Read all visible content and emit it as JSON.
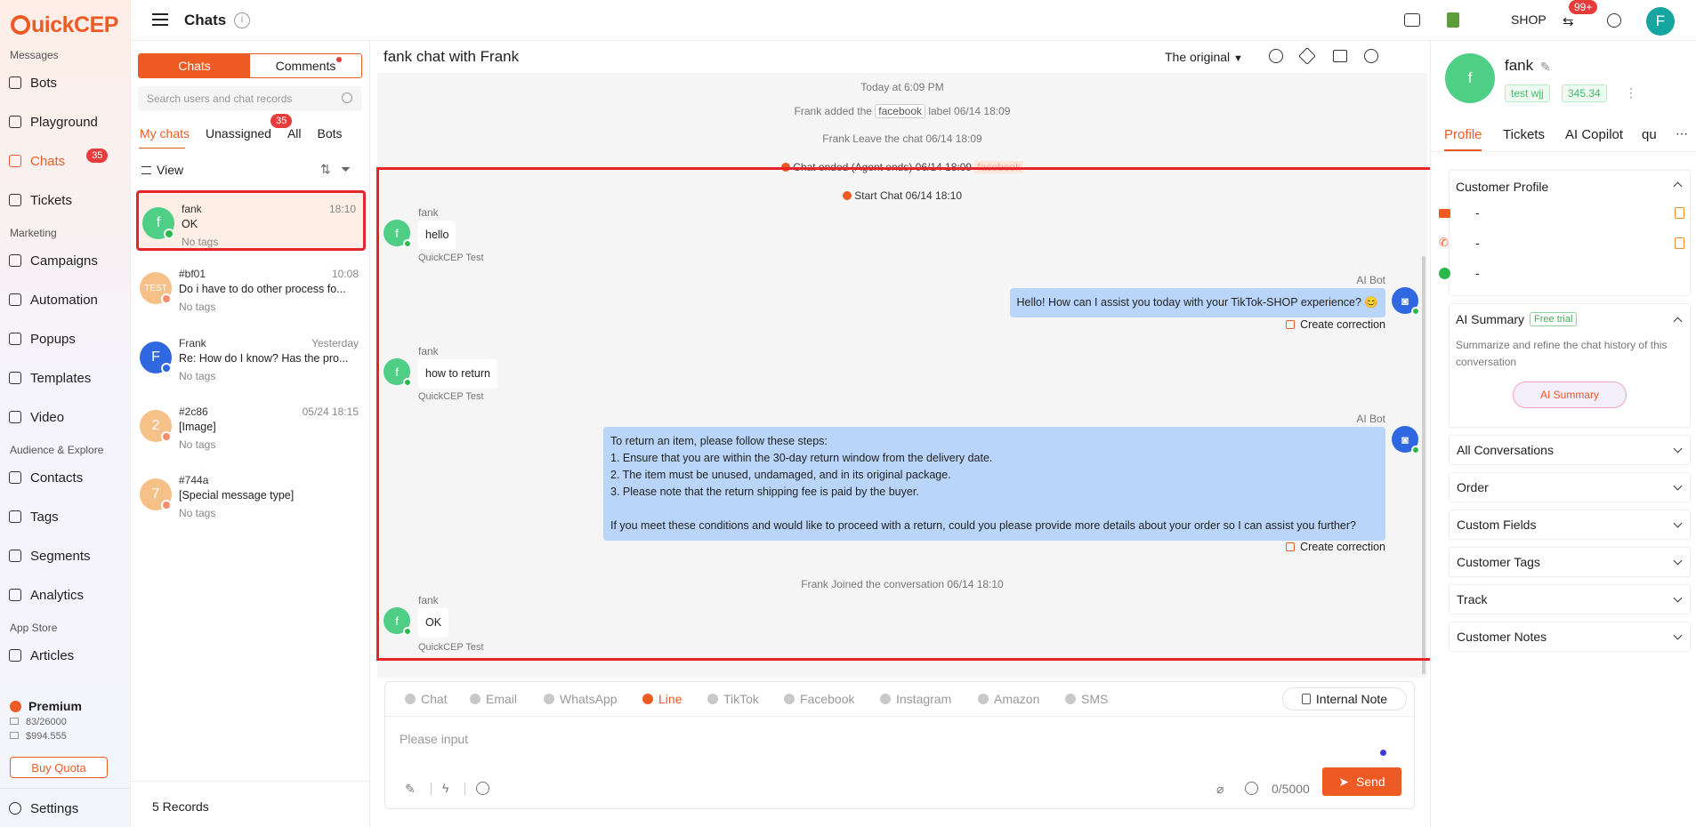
{
  "brand": {
    "logo_text": "uickCEP"
  },
  "sidebar": {
    "sections": [
      {
        "label": "Messages"
      },
      {
        "label": "Marketing"
      },
      {
        "label": "Audience & Explore"
      },
      {
        "label": "App Store"
      }
    ],
    "items": [
      {
        "label": "Bots",
        "icon": "bot-icon"
      },
      {
        "label": "Playground",
        "icon": "play-icon"
      },
      {
        "label": "Chats",
        "icon": "chat-icon",
        "badge": "35",
        "active": true
      },
      {
        "label": "Tickets",
        "icon": "ticket-icon"
      },
      {
        "label": "Campaigns",
        "icon": "send-icon"
      },
      {
        "label": "Automation",
        "icon": "automation-icon"
      },
      {
        "label": "Popups",
        "icon": "popup-icon"
      },
      {
        "label": "Templates",
        "icon": "template-icon"
      },
      {
        "label": "Video",
        "icon": "video-icon"
      },
      {
        "label": "Contacts",
        "icon": "user-icon"
      },
      {
        "label": "Tags",
        "icon": "tag-icon"
      },
      {
        "label": "Segments",
        "icon": "segments-icon"
      },
      {
        "label": "Analytics",
        "icon": "bulb-icon"
      },
      {
        "label": "Articles",
        "icon": "article-icon"
      }
    ],
    "plan": {
      "name": "Premium",
      "usage": "83/26000",
      "balance": "$994.555",
      "buy_label": "Buy Quota"
    },
    "settings_label": "Settings"
  },
  "topbar": {
    "title": "Chats",
    "shop_label": "SHOP",
    "notif_badge": "99+",
    "avatar_letter": "F"
  },
  "chatlist": {
    "seg_tabs": [
      "Chats",
      "Comments"
    ],
    "search_placeholder": "Search users and chat records",
    "filter_tabs": [
      {
        "label": "My chats",
        "active": true
      },
      {
        "label": "Unassigned",
        "badge": "35"
      },
      {
        "label": "All"
      },
      {
        "label": "Bots"
      }
    ],
    "view_label": "View",
    "chats": [
      {
        "name": "fank",
        "time": "18:10",
        "message": "OK",
        "tags": "No tags",
        "avatar": "f",
        "color": "#4fcf86",
        "selected": true
      },
      {
        "name": "#bf01",
        "time": "10:08",
        "message": "Do i have to do other process fo...",
        "tags": "No tags",
        "avatar": "TEST",
        "color": "#f6c089"
      },
      {
        "name": "Frank",
        "time": "Yesterday",
        "message": "Re: How do I know? Has the pro...",
        "tags": "No tags",
        "avatar": "F",
        "color": "#2f68e0"
      },
      {
        "name": "#2c86",
        "time": "05/24 18:15",
        "message": "[Image]",
        "tags": "No tags",
        "avatar": "2",
        "color": "#f6c089"
      },
      {
        "name": "#744a",
        "time": "",
        "message": "[Special message type]",
        "tags": "No tags",
        "avatar": "7",
        "color": "#f6c089"
      }
    ],
    "records": "5 Records"
  },
  "chat": {
    "title": "fank chat with Frank",
    "original_label": "The original",
    "events": {
      "today": "Today at 6:09 PM",
      "label_pre": "Frank added the",
      "label_chip": "facebook",
      "label_post": "label   06/14 18:09",
      "leave": "Frank Leave the chat   06/14 18:09",
      "ended": "Chat ended (Agent ends)   06/14 18:09",
      "ended_chip": "facebook",
      "start": "Start Chat   06/14 18:10",
      "joined": "Frank Joined the conversation   06/14 18:10"
    },
    "user_name": "fank",
    "source": "QuickCEP Test",
    "bot_name": "AI Bot",
    "msg1": "hello",
    "bot1": "Hello! How can I assist you today with your TikTok-SHOP experience? 😊",
    "msg2": "how to return",
    "bot2_lines": [
      "To return an item, please follow these steps:",
      "1. Ensure that you are within the 30-day return window from the delivery date.",
      "2. The item must be unused, undamaged, and in its original package.",
      "3. Please note that the return shipping fee is paid by the buyer.",
      "",
      "If you meet these conditions and would like to proceed with a return, could you please provide more details about your order so I can assist you further?"
    ],
    "msg3": "OK",
    "correction": "Create correction"
  },
  "composer": {
    "channels": [
      {
        "label": "Chat"
      },
      {
        "label": "Email"
      },
      {
        "label": "WhatsApp"
      },
      {
        "label": "Line",
        "active": true
      },
      {
        "label": "TikTok"
      },
      {
        "label": "Facebook"
      },
      {
        "label": "Instagram"
      },
      {
        "label": "Amazon"
      },
      {
        "label": "SMS"
      }
    ],
    "internal_note": "Internal Note",
    "placeholder": "Please input",
    "counter": "0/5000",
    "send": "Send"
  },
  "profile": {
    "name": "fank",
    "avatar": "f",
    "tags": [
      "test wjj",
      "345.34"
    ],
    "tabs": [
      "Profile",
      "Tickets",
      "AI Copilot",
      "qu"
    ],
    "customer_profile": "Customer Profile",
    "fields": [
      "-",
      "-",
      "-"
    ],
    "ai_summary": "AI Summary",
    "free_trial": "Free trial",
    "ai_desc": "Summarize and refine the chat history of this conversation",
    "ai_button": "AI Summary",
    "sections": [
      "All Conversations",
      "Order",
      "Custom Fields",
      "Customer Tags",
      "Track",
      "Customer Notes"
    ]
  },
  "colors": {
    "accent": "#ee5a24",
    "bot_bubble": "#b9d5f9",
    "highlight": "#e5242b"
  }
}
